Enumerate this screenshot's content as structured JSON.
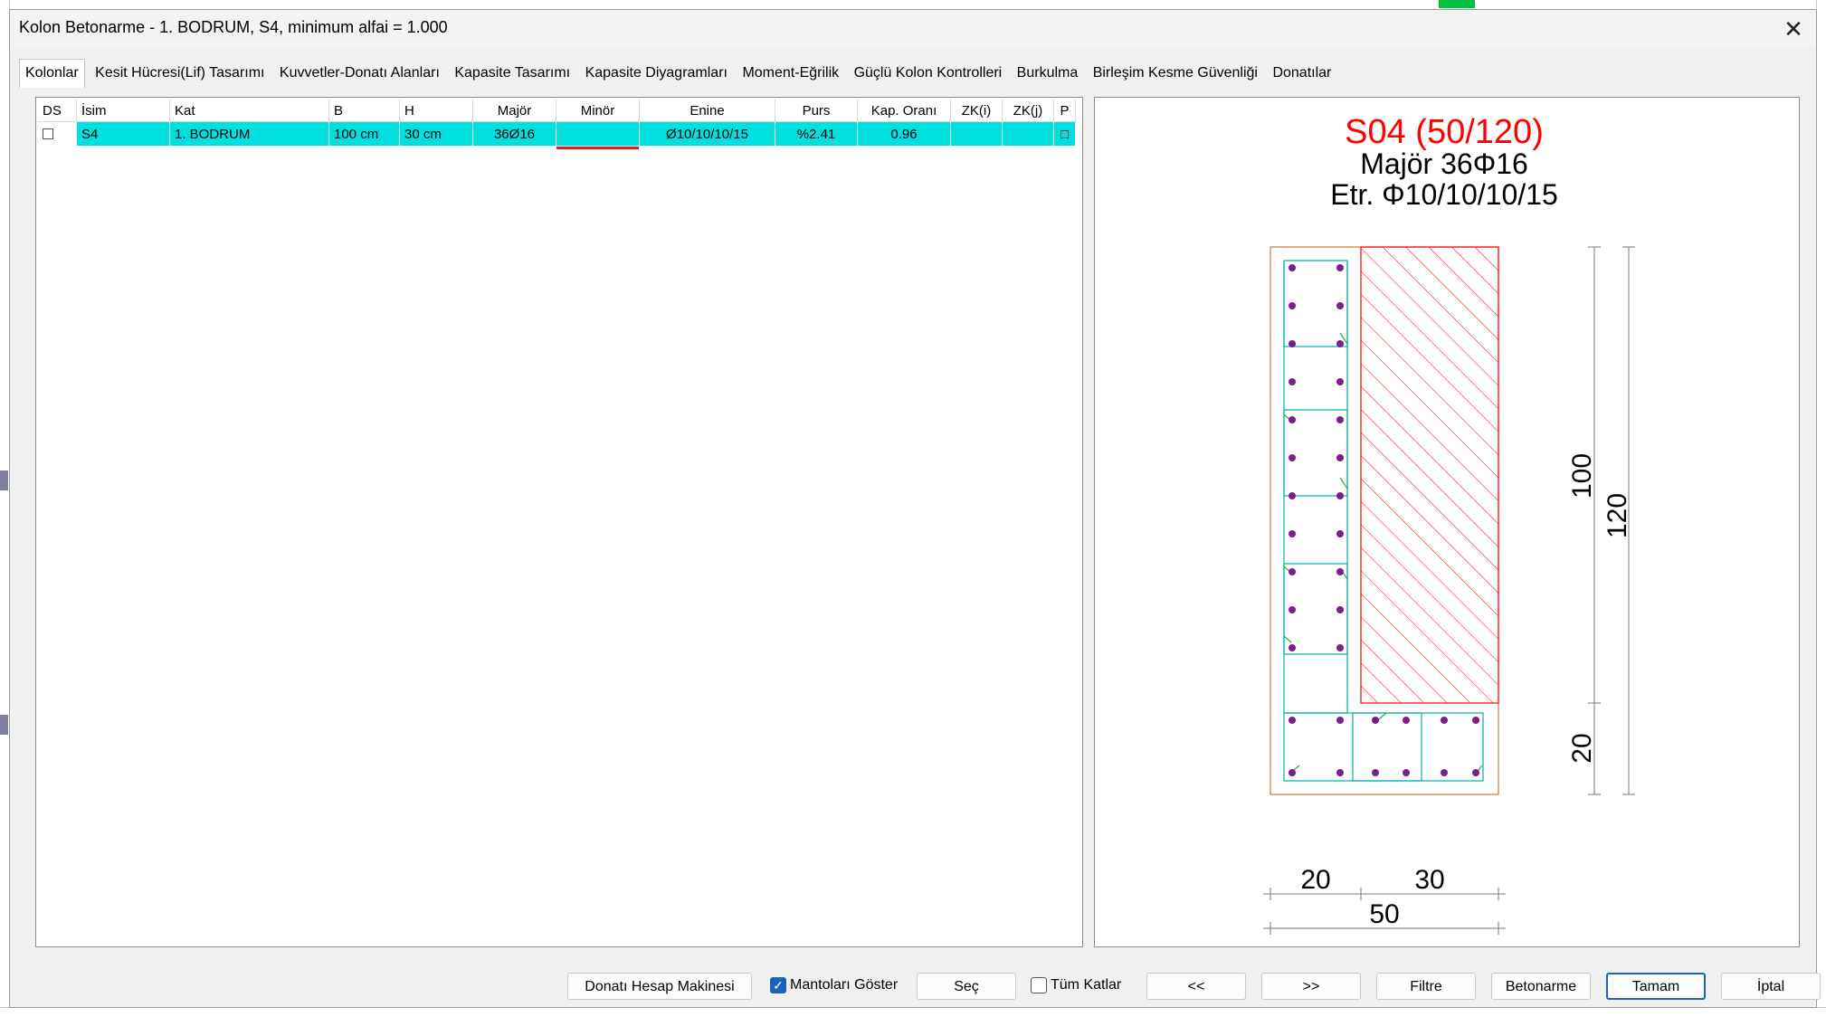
{
  "window": {
    "title": "Kolon Betonarme - 1. BODRUM, S4, minimum alfai = 1.000",
    "close_glyph": "✕"
  },
  "tabs": [
    {
      "label": "Kolonlar",
      "active": true
    },
    {
      "label": "Kesit Hücresi(Lif) Tasarımı"
    },
    {
      "label": "Kuvvetler-Donatı Alanları"
    },
    {
      "label": "Kapasite Tasarımı"
    },
    {
      "label": "Kapasite Diyagramları"
    },
    {
      "label": "Moment-Eğrilik"
    },
    {
      "label": "Güçlü Kolon Kontrolleri"
    },
    {
      "label": "Burkulma"
    },
    {
      "label": "Birleşim Kesme Güvenliği"
    },
    {
      "label": "Donatılar"
    }
  ],
  "table": {
    "headers": [
      "DS",
      "İsim",
      "Kat",
      "B",
      "H",
      "Majör",
      "Minör",
      "Enine",
      "Purs",
      "Kap. Oranı",
      "ZK(i)",
      "ZK(j)",
      "P"
    ],
    "rows": [
      {
        "ds": "",
        "isim": "S4",
        "kat": "1. BODRUM",
        "b": "100 cm",
        "h": "30 cm",
        "major": "36Ø16",
        "minor": "",
        "enine": "Ø10/10/10/15",
        "purs": "%2.41",
        "kap": "0.96",
        "zki": "",
        "zkj": "",
        "p": "□"
      }
    ]
  },
  "drawing": {
    "title": "S04 (50/120)",
    "line1": "Majör 36Φ16",
    "line2": "Etr. Φ10/10/10/15",
    "dims": {
      "h_inner_top": "100",
      "h_total": "120",
      "h_inner_bottom": "20",
      "w_left": "20",
      "w_right": "30",
      "w_total": "50"
    },
    "colors": {
      "title": "#ff0000",
      "outline": "#c87a3a",
      "hatch": "#ff0000",
      "stirrup": "#00b0b0",
      "bar": "#7a1e8a",
      "tie": "#30b030"
    }
  },
  "buttons": {
    "calc": "Donatı Hesap Makinesi",
    "mantolar": "Mantoları Göster",
    "sec": "Seç",
    "tum_katlar": "Tüm Katlar",
    "prev": "<<",
    "next": ">>",
    "filtre": "Filtre",
    "betonarme": "Betonarme",
    "tamam": "Tamam",
    "iptal": "İptal"
  },
  "checks": {
    "mantolar_checked": true,
    "tum_katlar_checked": false
  }
}
